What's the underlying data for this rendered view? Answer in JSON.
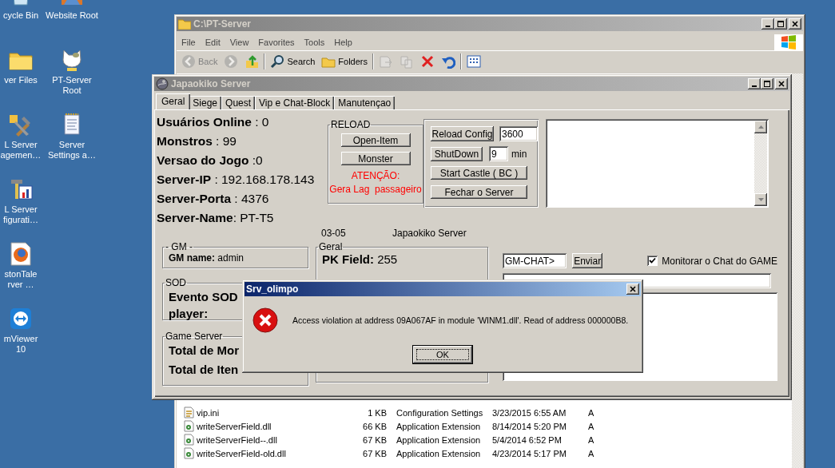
{
  "desktop_icons": [
    {
      "lines": [
        "cycle Bin"
      ]
    },
    {
      "lines": [
        "ver Files"
      ]
    },
    {
      "lines": [
        "L Server",
        "agemen…"
      ]
    },
    {
      "lines": [
        "L Server",
        "figurati…"
      ]
    },
    {
      "lines": [
        "stonTale",
        "rver …"
      ]
    },
    {
      "lines": [
        "mViewer",
        "10"
      ]
    },
    {
      "lines": [
        "Website Root"
      ]
    },
    {
      "lines": [
        "PT-Server",
        "Root"
      ]
    },
    {
      "lines": [
        "Server",
        "Settings a…"
      ]
    }
  ],
  "explorer": {
    "title": "C:\\PT-Server",
    "menu": [
      "File",
      "Edit",
      "View",
      "Favorites",
      "Tools",
      "Help"
    ],
    "toolbar": [
      {
        "kind": "back",
        "label": "Back",
        "disabled": true
      },
      {
        "kind": "forward",
        "disabled": true
      },
      {
        "kind": "up",
        "disabled": false
      },
      {
        "kind": "search",
        "label": "Search",
        "disabled": false
      },
      {
        "kind": "folders",
        "label": "Folders",
        "disabled": false
      },
      {
        "kind": "move",
        "disabled": true
      },
      {
        "kind": "copy",
        "disabled": true
      },
      {
        "kind": "delete",
        "disabled": false
      },
      {
        "kind": "undo",
        "disabled": false
      },
      {
        "kind": "views",
        "disabled": false
      }
    ],
    "files": [
      {
        "kind": "settings",
        "name": "vip.ini",
        "size": "1 KB",
        "type": "Configuration Settings",
        "modified": "3/23/2015 6:55 AM",
        "attributes": "A"
      },
      {
        "kind": "dll",
        "name": "writeServerField.dll",
        "size": "66 KB",
        "type": "Application Extension",
        "modified": "8/14/2014 5:20 PM",
        "attributes": "A"
      },
      {
        "kind": "dll",
        "name": "writeServerField--.dll",
        "size": "67 KB",
        "type": "Application Extension",
        "modified": "5/4/2014 6:52 PM",
        "attributes": "A"
      },
      {
        "kind": "dll",
        "name": "writeServerField-old.dll",
        "size": "67 KB",
        "type": "Application Extension",
        "modified": "4/23/2014 5:17 PM",
        "attributes": "A"
      }
    ]
  },
  "server": {
    "title": "Japaokiko Server",
    "tabs": [
      {
        "label": "Geral",
        "selected": true
      },
      {
        "label": "Siege",
        "selected": false
      },
      {
        "label": "Quest",
        "selected": false
      },
      {
        "label": "Vip e Chat-Block",
        "selected": false
      },
      {
        "label": "Manutençao",
        "selected": false
      }
    ],
    "info": [
      "**Usuários Online** : 0",
      "**Monstros** : 99",
      "**Versao do Jogo** :0",
      "**Server-IP** : 192.168.178.143",
      "**Server-Porta** : 4376",
      "**Server-Name**: PT-T5"
    ],
    "reload": {
      "title": "RELOAD",
      "buttons": [
        "Open-Item",
        "Monster"
      ],
      "warning": [
        "ATENÇÃO:",
        "Gera Lag  passageiro"
      ]
    },
    "controls": {
      "reload_config": "Reload Config",
      "reload_value": "3600",
      "shutdown": "ShutDown",
      "shutdown_value": "9",
      "shutdown_unit": "min",
      "start_castle": "Start Castle ( BC )",
      "close_server": "Fechar o Server"
    },
    "footer": [
      "03-05",
      "Japaokiko Server"
    ],
    "gm": {
      "title": "- GM -",
      "text": "**GM name:**  admin"
    },
    "sod": {
      "title": "SOD",
      "lines": [
        "Evento SOD",
        "player:"
      ]
    },
    "game_server": {
      "title": "Game Server",
      "lines": [
        "Total de Mor",
        "Total de Iten"
      ]
    },
    "geral": {
      "title": "Geral",
      "text": "**PK Field:** 255"
    },
    "chat": {
      "value": "GM-CHAT>",
      "send": "Enviar",
      "monitor": {
        "label": "Monitorar o Chat do GAME",
        "checked": true
      }
    }
  },
  "dialog": {
    "title": "Srv_olimpo",
    "message": "Access violation at address 09A067AF in module 'WINM1.dll'. Read of address 000000B8.",
    "button": "OK"
  }
}
